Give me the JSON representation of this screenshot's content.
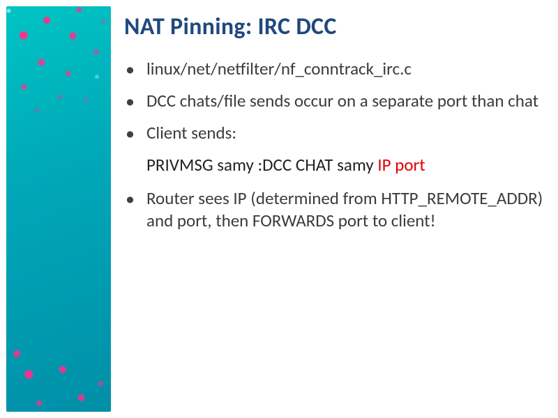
{
  "title": "NAT Pinning: IRC DCC",
  "bullets": {
    "b1": "linux/net/netfilter/nf_conntrack_irc.c",
    "b2": "DCC chats/file sends occur on a separate port than chat",
    "b3": "Client sends:",
    "b4": "Router sees IP (determined from HTTP_REMOTE_ADDR) and port, then FORWARDS port to client!"
  },
  "privmsg": {
    "prefix": "PRIVMSG samy :DCC CHAT samy ",
    "red": "IP port"
  }
}
